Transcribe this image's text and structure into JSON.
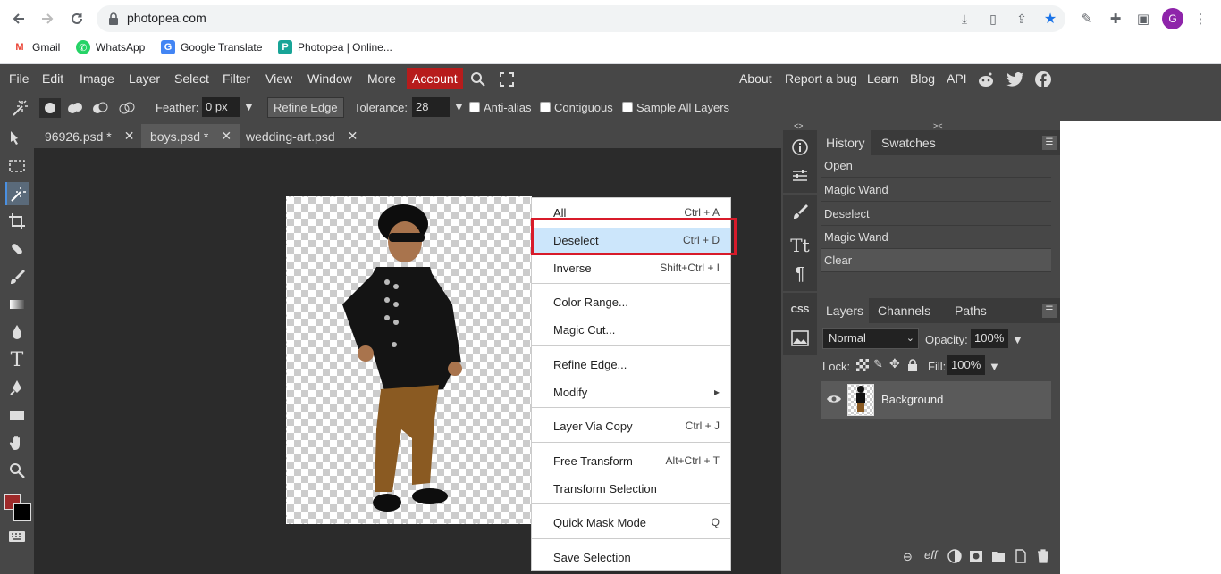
{
  "browser": {
    "url": "photopea.com",
    "bookmarks": [
      "Gmail",
      "WhatsApp",
      "Google Translate",
      "Photopea | Online..."
    ],
    "profile_initial": "G"
  },
  "menubar": {
    "items": [
      "File",
      "Edit",
      "Image",
      "Layer",
      "Select",
      "Filter",
      "View",
      "Window",
      "More"
    ],
    "account": "Account",
    "right_links": [
      "About",
      "Report a bug",
      "Learn",
      "Blog",
      "API"
    ]
  },
  "options": {
    "feather_label": "Feather:",
    "feather_value": "0 px",
    "refine_edge": "Refine Edge",
    "tolerance_label": "Tolerance:",
    "tolerance_value": "28",
    "anti_alias": "Anti-alias",
    "contiguous": "Contiguous",
    "sample_all_layers": "Sample All Layers"
  },
  "doc_tabs": [
    {
      "name": "96926.psd *",
      "close": "✕"
    },
    {
      "name": "boys.psd *",
      "close": "✕"
    },
    {
      "name": "wedding-art.psd",
      "close": "✕"
    }
  ],
  "context_menu": {
    "items": [
      {
        "label": "All",
        "shortcut": "Ctrl + A"
      },
      {
        "label": "Deselect",
        "shortcut": "Ctrl + D"
      },
      {
        "label": "Inverse",
        "shortcut": "Shift+Ctrl + I"
      },
      {
        "label": "Color Range...",
        "shortcut": ""
      },
      {
        "label": "Magic Cut...",
        "shortcut": ""
      },
      {
        "label": "Refine Edge...",
        "shortcut": ""
      },
      {
        "label": "Modify",
        "shortcut": "▸"
      },
      {
        "label": "Layer Via Copy",
        "shortcut": "Ctrl + J"
      },
      {
        "label": "Free Transform",
        "shortcut": "Alt+Ctrl + T"
      },
      {
        "label": "Transform Selection",
        "shortcut": ""
      },
      {
        "label": "Quick Mask Mode",
        "shortcut": "Q"
      },
      {
        "label": "Save Selection",
        "shortcut": ""
      }
    ]
  },
  "history_panel": {
    "tabs": [
      "History",
      "Swatches"
    ],
    "entries": [
      "Open",
      "Magic Wand",
      "Deselect",
      "Magic Wand",
      "Clear"
    ]
  },
  "layers_panel": {
    "tabs": [
      "Layers",
      "Channels",
      "Paths"
    ],
    "blend_mode": "Normal",
    "opacity_label": "Opacity:",
    "opacity_value": "100%",
    "lock_label": "Lock:",
    "fill_label": "Fill:",
    "fill_value": "100%",
    "layer_name": "Background"
  },
  "icon_strip": {
    "css_label": "CSS"
  },
  "colors": {
    "accent": "#b71c1c",
    "highlight": "#cce6fb",
    "outline": "#d81b2a"
  }
}
